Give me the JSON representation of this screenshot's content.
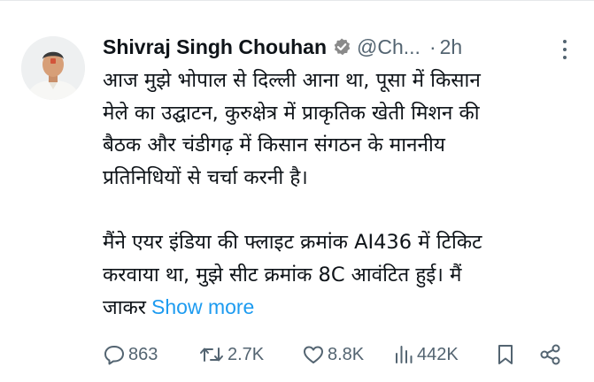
{
  "tweet": {
    "author_name": "Shivraj Singh Chouhan",
    "handle": "@Ch...",
    "separator": "·",
    "time": "2h",
    "body_lines": [
      "आज मुझे भोपाल से दिल्ली आना था, पूसा में किसान",
      "मेले का उद्घाटन, कुरुक्षेत्र में प्राकृतिक खेती मिशन की",
      "बैठक और चंडीगढ़ में किसान संगठन के माननीय",
      "प्रतिनिधियों से चर्चा करनी है।",
      "मैंने एयर इंडिया की फ्लाइट क्रमांक AI436 में टिकिट",
      "करवाया था, मुझे सीट क्रमांक 8C आवंटित हुई। मैं",
      "जाकर"
    ],
    "show_more": "Show more"
  },
  "actions": {
    "replies": "863",
    "reposts": "2.7K",
    "likes": "8.8K",
    "views": "442K"
  },
  "icons": {
    "verified": "verified-badge-icon",
    "more": "more-vertical-icon",
    "reply": "reply-icon",
    "repost": "repost-icon",
    "like": "heart-icon",
    "views": "views-chart-icon",
    "bookmark": "bookmark-icon",
    "share": "share-icon"
  },
  "colors": {
    "text": "#0f1419",
    "secondary": "#536471",
    "link": "#1d9bf0",
    "verified_badge": "#8a8a8a"
  }
}
